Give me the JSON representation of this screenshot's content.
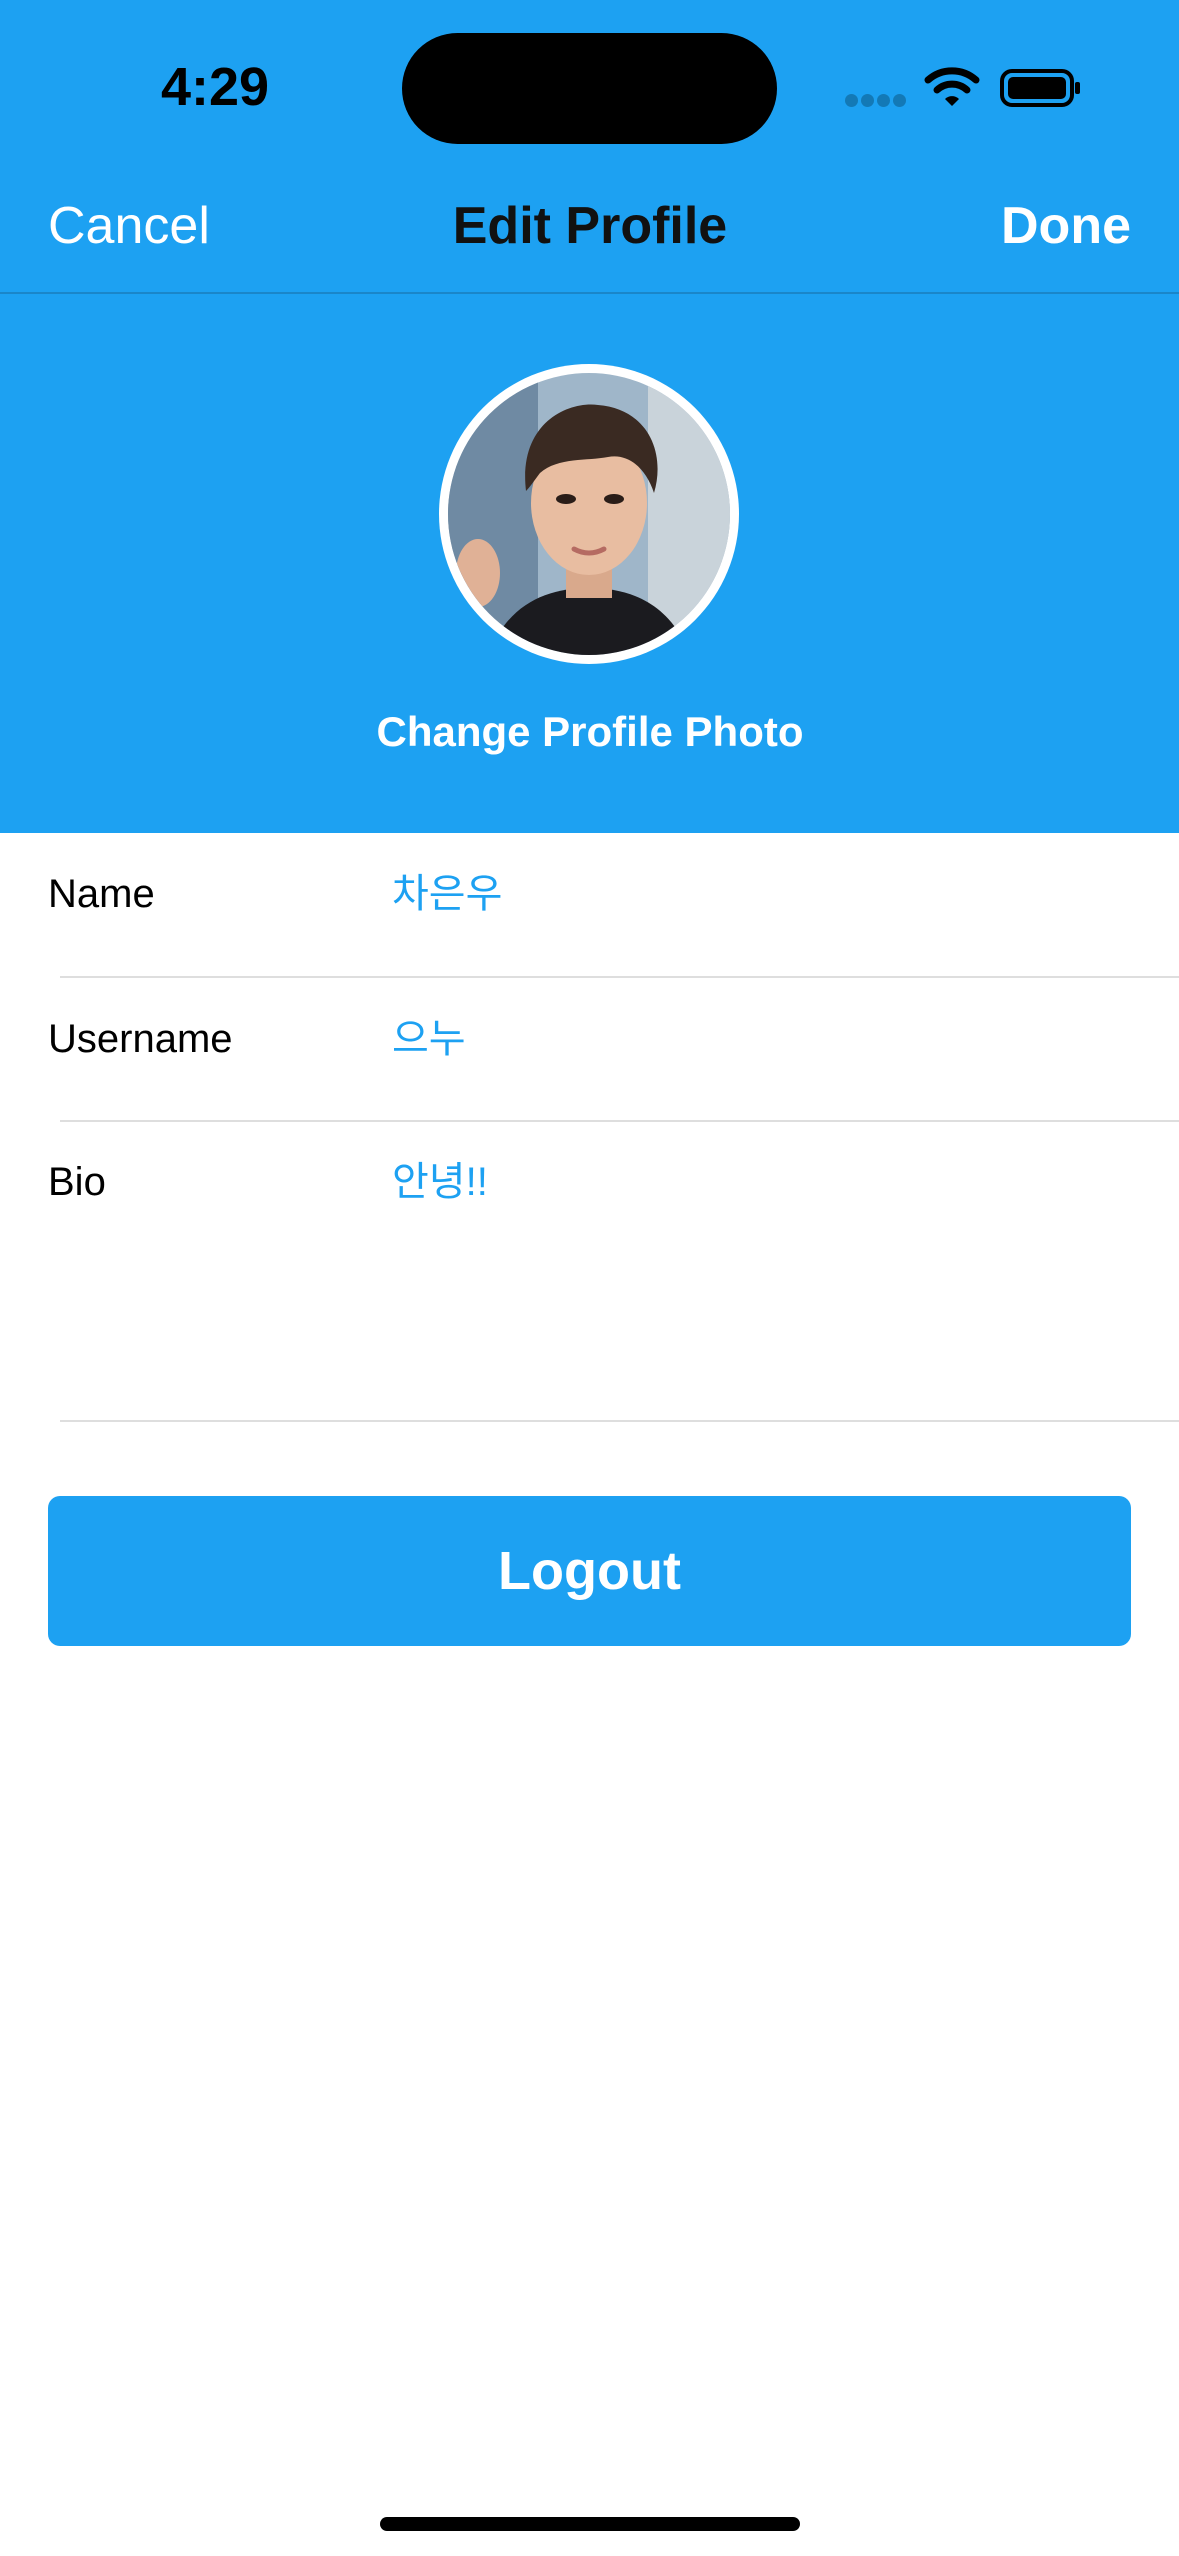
{
  "status_bar": {
    "time": "4:29"
  },
  "nav": {
    "cancel_label": "Cancel",
    "title": "Edit Profile",
    "done_label": "Done"
  },
  "profile": {
    "change_photo_label": "Change Profile Photo"
  },
  "form": {
    "name": {
      "label": "Name",
      "value": "차은우"
    },
    "username": {
      "label": "Username",
      "value": "으누"
    },
    "bio": {
      "label": "Bio",
      "value": "안녕!!"
    }
  },
  "logout_label": "Logout",
  "colors": {
    "accent": "#1DA1F2",
    "background": "#FFFFFF",
    "title_text": "#111111"
  },
  "icons": [
    "signal-icon",
    "wifi-icon",
    "battery-icon",
    "avatar"
  ]
}
